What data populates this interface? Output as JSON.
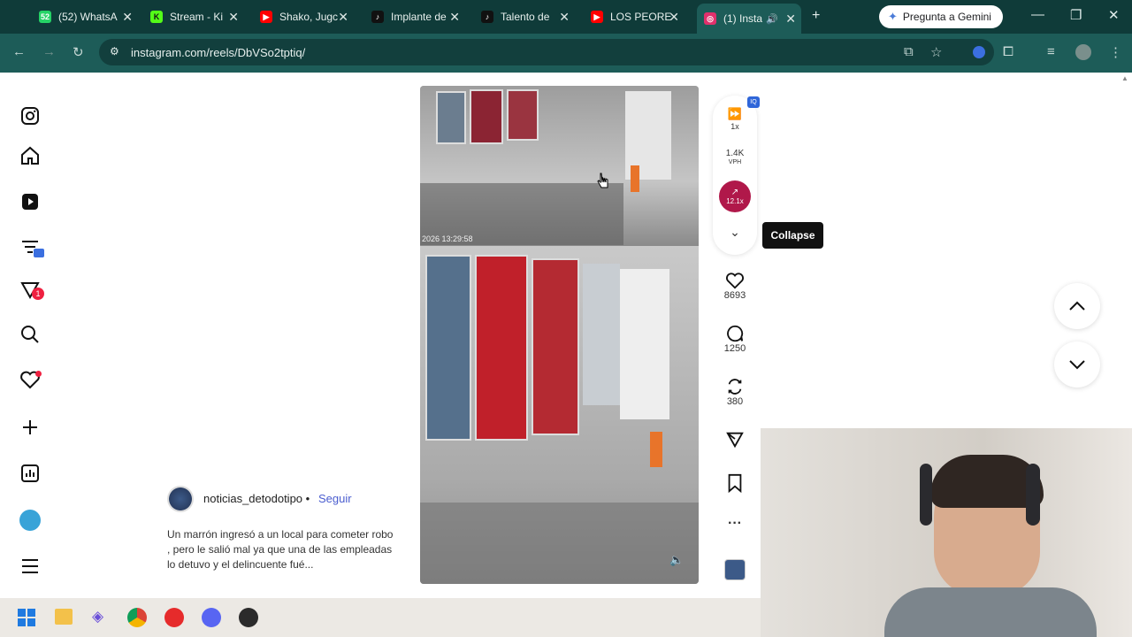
{
  "browser": {
    "tabs": [
      {
        "title": "(52) WhatsA",
        "icon": "whatsapp-icon",
        "color": "#25d366"
      },
      {
        "title": "Stream - Ki",
        "icon": "kick-icon",
        "color": "#53fc18"
      },
      {
        "title": "Shako, Jugc",
        "icon": "youtube-icon",
        "color": "#ff0000"
      },
      {
        "title": "Implante de",
        "icon": "tiktok-icon",
        "color": "#111111"
      },
      {
        "title": "Talento de",
        "icon": "tiktok-icon",
        "color": "#111111"
      },
      {
        "title": "LOS PEORE",
        "icon": "youtube-icon",
        "color": "#ff0000"
      },
      {
        "title": "(1) Insta",
        "icon": "instagram-icon",
        "color": "#e1306c",
        "active": true
      }
    ],
    "gemini_label": "Pregunta a Gemini",
    "url": "instagram.com/reels/DbVSo2tptiq/"
  },
  "video": {
    "timestamp": "2026 13:29:58"
  },
  "side": {
    "speed": "1x",
    "vph_value": "1.4K",
    "vph_label": "VPH",
    "trend_value": "12.1x",
    "tooltip": "Collapse",
    "likes": "8693",
    "comments": "1250",
    "reposts": "380"
  },
  "post": {
    "username": "noticias_detodotipo",
    "separator": "•",
    "follow": "Seguir",
    "caption": "Un marrón ingresó a un local para cometer robo , pero le salió mal ya que una de las empleadas lo detuvo y el delincuente fué..."
  },
  "rail": {
    "notif_badge": "1"
  }
}
